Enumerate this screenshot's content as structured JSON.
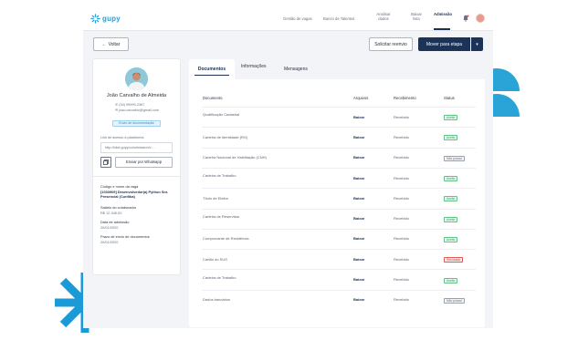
{
  "brand": {
    "name": "gupy",
    "accent": "#2a9fd8",
    "navy": "#1c3257"
  },
  "nav": [
    {
      "label": "Gestão de vagas"
    },
    {
      "label": "Banco de Talentos"
    },
    {
      "label": "Analisar dados"
    },
    {
      "label": "Baixar lista"
    },
    {
      "label": "Admissão",
      "active": true
    }
  ],
  "toolbar": {
    "back_label": "Voltar",
    "request_label": "Solicitar reenvio",
    "move_label": "Mover para etapa"
  },
  "candidate": {
    "name": "João Carvalho de Almeida",
    "phone": "(34) 99999-2367",
    "email": "joao.carvalho@gmail.com",
    "send_docs_label": "Envio de documentação",
    "link_label": "Link de acesso à plataforma",
    "link_value": "http://idiot.gupy.io/admission/c...",
    "whatsapp_label": "Enviar por Whatsapp",
    "job_code_label": "Código e nome da vaga",
    "job_code_value": "[1033909] Desenvolvedor(a) Python Snr. Presencial (Curitiba)",
    "salary_label": "Salário do colaborador",
    "salary_value": "R$ 12.345,00",
    "admission_date_label": "Data de admissão",
    "admission_date_value": "20/01/2020",
    "deadline_label": "Prazo de envio de documentos",
    "deadline_value": "20/01/2020"
  },
  "tabs": [
    {
      "label": "Documentos",
      "active": true
    },
    {
      "label": "Informações"
    },
    {
      "label": "Mensagens"
    }
  ],
  "table": {
    "headers": [
      "Documento",
      "Arquivos",
      "Recebimento",
      "Status"
    ],
    "rows": [
      {
        "doc": "Qualificação Cadastral",
        "file": "Baixar",
        "received": "Recebido",
        "status": "Aceito",
        "kind": "ok"
      },
      {
        "doc": "Carteira de Identidade (RG)",
        "file": "Baixar",
        "received": "Recebido",
        "status": "Aceito",
        "kind": "ok"
      },
      {
        "doc": "Carteira Nacional de Habilitação (CNH)",
        "file": "Baixar",
        "received": "Recebido",
        "status": "Não possui",
        "kind": "warn"
      },
      {
        "doc": "Carteira de Trabalho",
        "file": "Baixar",
        "received": "Recebido",
        "status": "Aceito",
        "kind": "ok"
      },
      {
        "doc": "Título de Eleitor",
        "file": "Baixar",
        "received": "Recebido",
        "status": "Aceito",
        "kind": "ok"
      },
      {
        "doc": "Carteira de Reservista",
        "file": "Baixar",
        "received": "Recebido",
        "status": "Aceito",
        "kind": "ok"
      },
      {
        "doc": "Comprovante de Residência",
        "file": "Baixar",
        "received": "Recebido",
        "status": "Aceito",
        "kind": "ok"
      },
      {
        "doc": "Cartão do SUS",
        "file": "Baixar",
        "received": "Recebido",
        "status": "Recusado",
        "kind": "bad"
      },
      {
        "doc": "Carteira de Trabalho",
        "file": "Baixar",
        "received": "Recebido",
        "status": "Aceito",
        "kind": "ok"
      },
      {
        "doc": "Dados bancários",
        "file": "Baixar",
        "received": "Recebido",
        "status": "Não possui",
        "kind": "warn"
      }
    ]
  },
  "icons": {
    "logo": "gupy-logo-icon",
    "bell": "bell-icon",
    "back": "arrow-left-icon",
    "caret": "chevron-down-icon",
    "phone": "phone-icon",
    "email": "mail-icon",
    "copy": "copy-icon"
  }
}
